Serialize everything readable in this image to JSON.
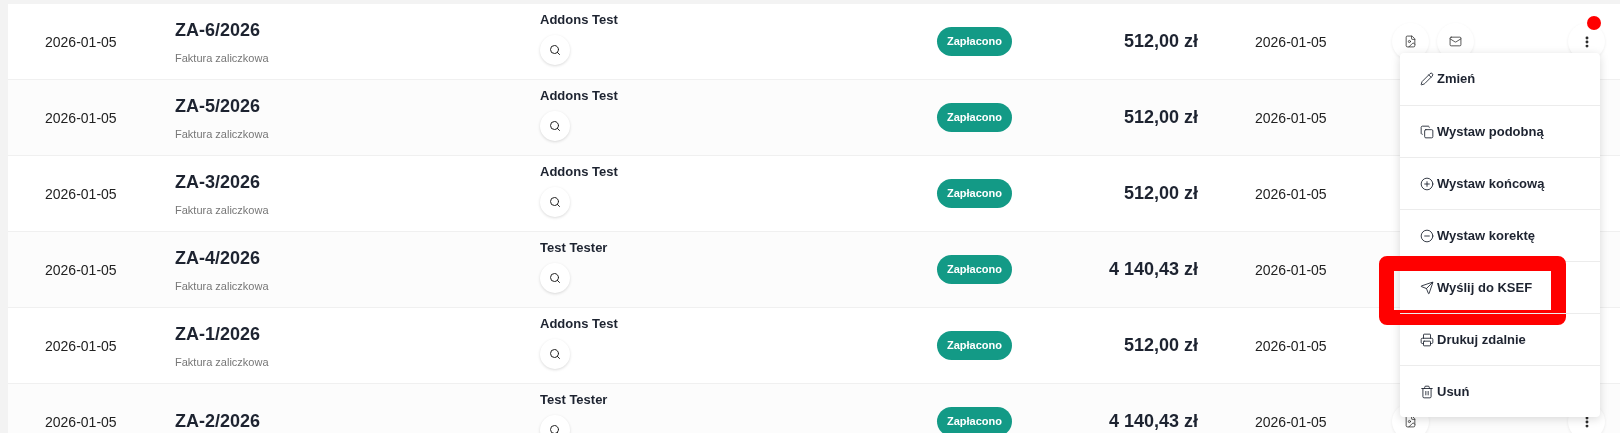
{
  "rows": [
    {
      "date": "2026-01-05",
      "number": "ZA-6/2026",
      "type": "Faktura zaliczkowa",
      "client": "Addons Test",
      "status": "Zapłacono",
      "amount": "512,00 zł",
      "due": "2026-01-05",
      "actions": [
        {
          "kind": "pdf"
        },
        {
          "kind": "mail"
        },
        {
          "kind": "more"
        }
      ],
      "menu_notice": true
    },
    {
      "date": "2026-01-05",
      "number": "ZA-5/2026",
      "type": "Faktura zaliczkowa",
      "client": "Addons Test",
      "status": "Zapłacono",
      "amount": "512,00 zł",
      "due": "2026-01-05",
      "actions": [],
      "menu_notice": false
    },
    {
      "date": "2026-01-05",
      "number": "ZA-3/2026",
      "type": "Faktura zaliczkowa",
      "client": "Addons Test",
      "status": "Zapłacono",
      "amount": "512,00 zł",
      "due": "2026-01-05",
      "actions": [],
      "menu_notice": false
    },
    {
      "date": "2026-01-05",
      "number": "ZA-4/2026",
      "type": "Faktura zaliczkowa",
      "client": "Test Tester",
      "status": "Zapłacono",
      "amount": "4 140,43 zł",
      "due": "2026-01-05",
      "actions": [],
      "menu_notice": false
    },
    {
      "date": "2026-01-05",
      "number": "ZA-1/2026",
      "type": "Faktura zaliczkowa",
      "client": "Addons Test",
      "status": "Zapłacono",
      "amount": "512,00 zł",
      "due": "2026-01-05",
      "actions": [],
      "menu_notice": false
    },
    {
      "date": "2026-01-05",
      "number": "ZA-2/2026",
      "client": "Test Tester",
      "status": "Zapłacono",
      "amount": "4 140,43 zł",
      "due": "2026-01-05",
      "actions": [
        {
          "kind": "pdf"
        },
        {
          "kind": "more"
        }
      ],
      "menu_notice": false
    }
  ],
  "menu": {
    "items": [
      {
        "kind": "edit",
        "label": "Zmień",
        "highlighted": false
      },
      {
        "kind": "copy",
        "label": "Wystaw podobną",
        "highlighted": false
      },
      {
        "kind": "plus",
        "label": "Wystaw końcową",
        "highlighted": false
      },
      {
        "kind": "minus",
        "label": "Wystaw korektę",
        "highlighted": false
      },
      {
        "kind": "send",
        "label": "Wyślij do KSEF",
        "highlighted": true
      },
      {
        "kind": "print",
        "label": "Drukuj zdalnie",
        "highlighted": false
      },
      {
        "kind": "trash",
        "label": "Usuń",
        "highlighted": false
      }
    ]
  }
}
